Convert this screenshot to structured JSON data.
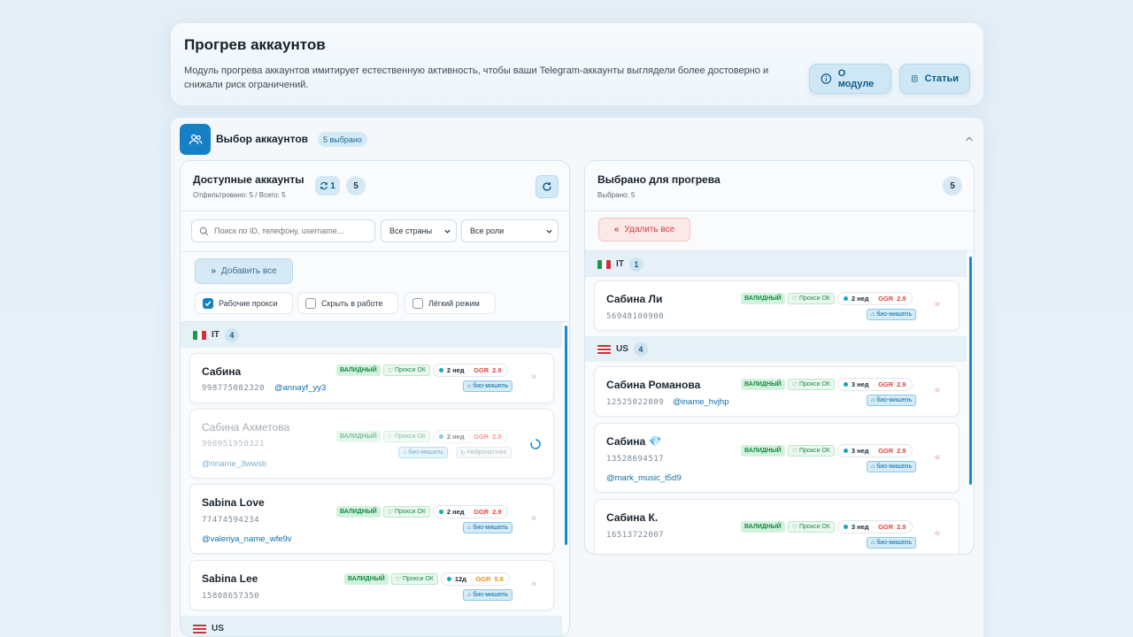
{
  "header": {
    "title": "Прогрев аккаунтов",
    "description": "Модуль прогрева аккаунтов имитирует естественную активность, чтобы ваши Telegram-аккаунты выглядели более достоверно и снижали риск ограничений.",
    "about_label": "О модуле",
    "articles_label": "Статьи"
  },
  "selection": {
    "title": "Выбор аккаунтов",
    "selected_badge": "5 выбрано"
  },
  "available": {
    "title": "Доступные аккаунты",
    "subtitle": "Отфильтровано: 5 / Всего: 5",
    "sync_count": "1",
    "count": "5",
    "search_placeholder": "Поиск по ID, телефону, username...",
    "country_select": "Все страны",
    "role_select": "Все роли",
    "add_all_label": "Добавить все",
    "filters": [
      {
        "label": "Рабочие прокси",
        "checked": true
      },
      {
        "label": "Скрыть в работе",
        "checked": false
      },
      {
        "label": "Лёгкий режим",
        "checked": false
      }
    ],
    "groups": [
      {
        "country": "IT",
        "count": "4"
      },
      {
        "country": "US",
        "count": ""
      }
    ],
    "accounts": [
      {
        "name": "Сабина",
        "phone": "998775082320",
        "username": "@annayf_yy3",
        "status": "ВАЛИДНЫЙ",
        "proxy": "Прокси ОК",
        "age": "2 нед",
        "ggr_label": "GGR",
        "ggr": "2.9",
        "role": "био-мишель"
      },
      {
        "name": "Сабина Ахметова",
        "phone": "998951950321",
        "username": "@nname_3wwsb",
        "status": "ВАЛИДНЫЙ",
        "proxy": "Прокси ОК",
        "age": "2 нед",
        "ggr_label": "GGR",
        "ggr": "2.9",
        "role": "био-мишель",
        "extra": "Нейрочаттинг"
      },
      {
        "name": "Sabina Love",
        "phone": "77474594234",
        "username": "@valeriya_name_wfe9v",
        "status": "ВАЛИДНЫЙ",
        "proxy": "Прокси ОК",
        "age": "2 нед",
        "ggr_label": "GGR",
        "ggr": "2.9",
        "role": "био-мишель"
      },
      {
        "name": "Sabina Lee",
        "phone": "15808657350",
        "status": "ВАЛИДНЫЙ",
        "proxy": "Прокси ОК",
        "age": "12д",
        "ggr_label": "GGR",
        "ggr": "5.8",
        "role": "био-мишель"
      }
    ]
  },
  "selected": {
    "title": "Выбрано для прогрева",
    "subtitle": "Выбрано: 5",
    "count": "5",
    "delete_all_label": "Удалить все",
    "groups": [
      {
        "country": "IT",
        "count": "1"
      },
      {
        "country": "US",
        "count": "4"
      }
    ],
    "accounts": [
      {
        "name": "Сабина Ли",
        "phone": "56948100900",
        "status": "ВАЛИДНЫЙ",
        "proxy": "Прокси ОК",
        "age": "2 нед",
        "ggr_label": "GGR",
        "ggr": "2.9",
        "role": "био-мишель"
      },
      {
        "name": "Сабина Романова",
        "phone": "12525022809",
        "username": "@iname_hvjhp",
        "status": "ВАЛИДНЫЙ",
        "proxy": "Прокси ОК",
        "age": "3 нед",
        "ggr_label": "GGR",
        "ggr": "2.9",
        "role": "био-мишель"
      },
      {
        "name": "Сабина",
        "emoji": "💎",
        "phone": "13528694517",
        "username": "@mark_music_t5d9",
        "status": "ВАЛИДНЫЙ",
        "proxy": "Прокси ОК",
        "age": "3 нед",
        "ggr_label": "GGR",
        "ggr": "2.9",
        "role": "био-мишель"
      },
      {
        "name": "Сабина К.",
        "phone": "16513722007",
        "status": "ВАЛИДНЫЙ",
        "proxy": "Прокси ОК",
        "age": "3 нед",
        "ggr_label": "GGR",
        "ggr": "2.9",
        "role": "био-мишель"
      }
    ]
  },
  "colors": {
    "accent": "#1680c4",
    "valid": "#138a42",
    "ggr_red": "#e0463c",
    "ggr_orange": "#e59520",
    "danger": "#d43f3f"
  }
}
